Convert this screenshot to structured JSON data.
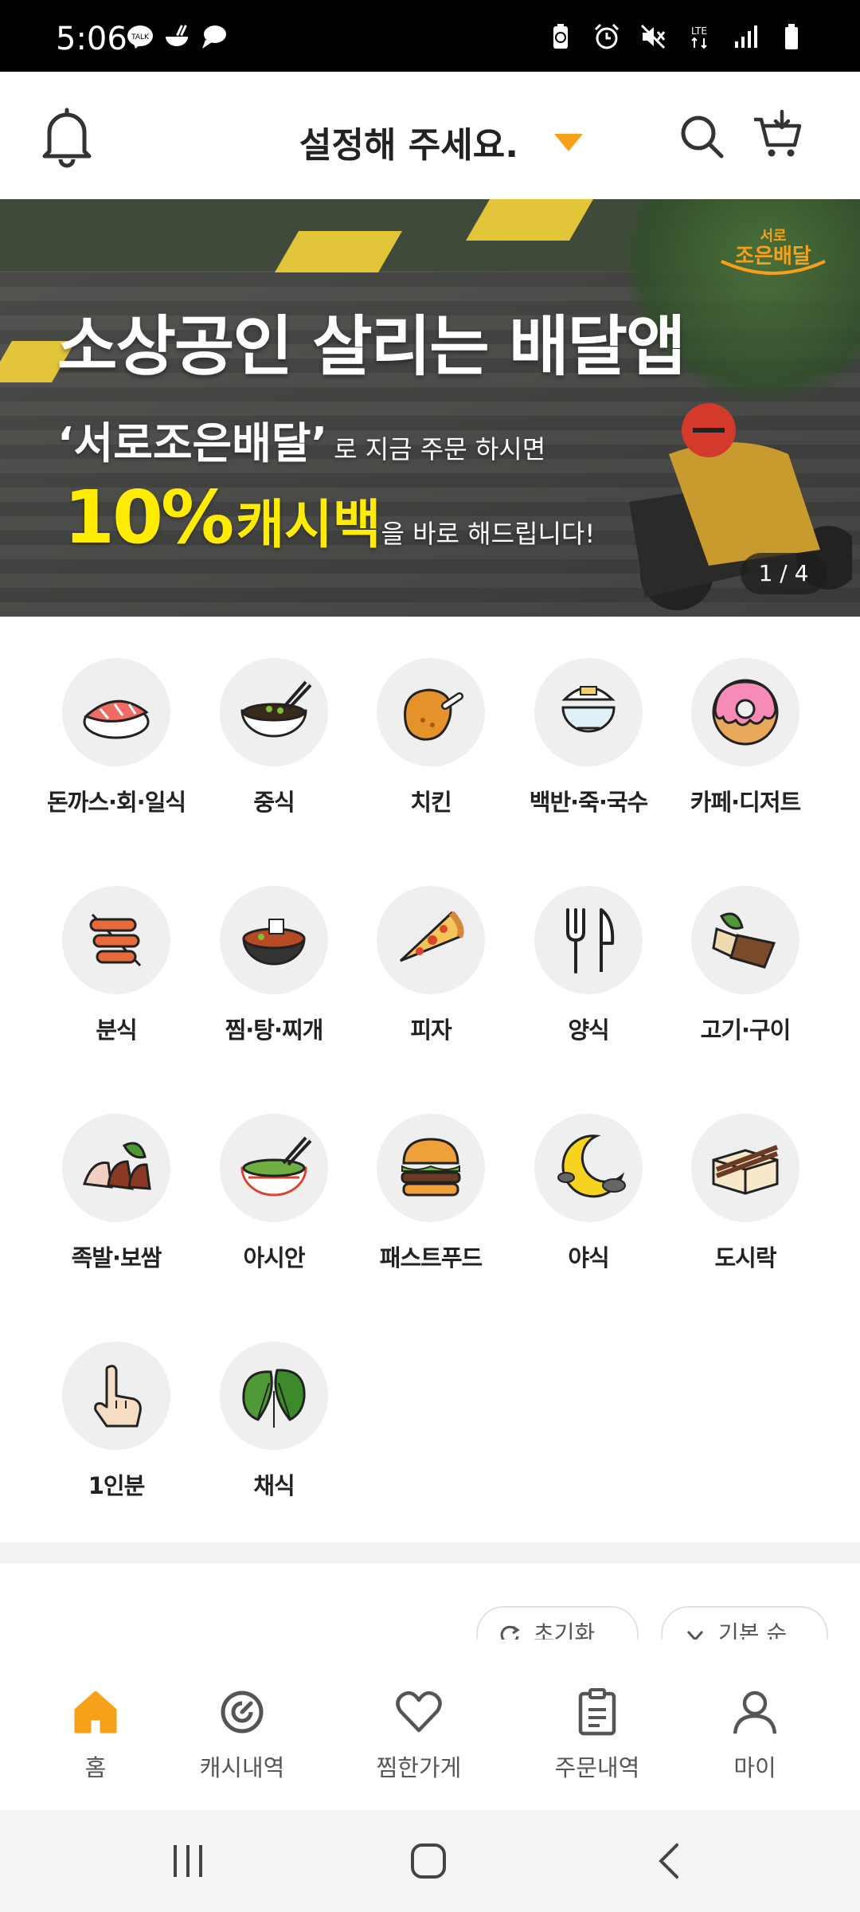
{
  "status_bar": {
    "time": "5:06",
    "left_icons": [
      "kakaotalk-icon",
      "food-app-icon",
      "chat-bubble-icon"
    ],
    "right_icons": [
      "battery-saver-icon",
      "alarm-icon",
      "mute-icon",
      "lte-icon",
      "signal-icon",
      "battery-icon"
    ],
    "network": "LTE"
  },
  "header": {
    "location_label": "설정해 주세요.",
    "accent_color": "#f7a11a"
  },
  "banner": {
    "logo_top": "서로",
    "logo_main": "조은배달",
    "headline": "소상공인 살리는 배달앱",
    "line2_bold": "‘서로조은배달’",
    "line2_rest": "로 지금 주문 하시면",
    "line3_percent": "10%",
    "line3_cashback": "캐시백",
    "line3_rest": "을 바로 해드립니다!",
    "pager": "1 / 4"
  },
  "categories": [
    {
      "label": "돈까스·회·일식",
      "icon": "sushi-icon"
    },
    {
      "label": "중식",
      "icon": "noodle-bowl-icon"
    },
    {
      "label": "치킨",
      "icon": "chicken-leg-icon"
    },
    {
      "label": "백반·죽·국수",
      "icon": "rice-bowl-icon"
    },
    {
      "label": "카페·디저트",
      "icon": "donut-icon"
    },
    {
      "label": "분식",
      "icon": "skewer-icon"
    },
    {
      "label": "찜·탕·찌개",
      "icon": "stew-pot-icon"
    },
    {
      "label": "피자",
      "icon": "pizza-icon"
    },
    {
      "label": "양식",
      "icon": "fork-knife-icon"
    },
    {
      "label": "고기·구이",
      "icon": "grilled-meat-icon"
    },
    {
      "label": "족발·보쌈",
      "icon": "pork-hock-icon"
    },
    {
      "label": "아시안",
      "icon": "pho-bowl-icon"
    },
    {
      "label": "패스트푸드",
      "icon": "burger-icon"
    },
    {
      "label": "야식",
      "icon": "moon-icon"
    },
    {
      "label": "도시락",
      "icon": "lunchbox-icon"
    },
    {
      "label": "1인분",
      "icon": "one-finger-icon"
    },
    {
      "label": "채식",
      "icon": "leaf-icon"
    }
  ],
  "filters": {
    "reset_label": "초기화",
    "sort_label": "기본 순"
  },
  "bottom_nav": [
    {
      "label": "홈",
      "icon": "home-icon",
      "active": true
    },
    {
      "label": "캐시내역",
      "icon": "cash-history-icon",
      "active": false
    },
    {
      "label": "찜한가게",
      "icon": "heart-icon",
      "active": false
    },
    {
      "label": "주문내역",
      "icon": "clipboard-icon",
      "active": false
    },
    {
      "label": "마이",
      "icon": "user-icon",
      "active": false
    }
  ],
  "system_nav": [
    "recent-apps-icon",
    "home-circle-icon",
    "back-icon"
  ]
}
